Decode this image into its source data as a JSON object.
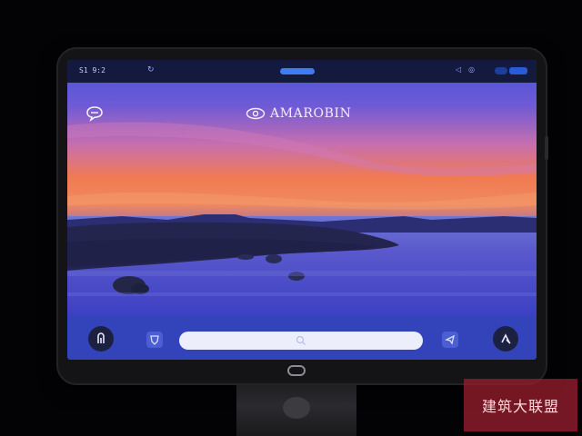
{
  "device": {
    "screen": {
      "status_bar": {
        "time": "S1 9:2",
        "icons": [
          "sync-icon",
          "cast-icon",
          "wifi-icon",
          "battery-icon"
        ]
      },
      "menu_icon": "chat-bubble-icon",
      "brand": {
        "icon": "eye-logo-icon",
        "label": "AMAROBIN"
      },
      "dock": {
        "left_button": "exit-icon",
        "left_square": "shield-icon",
        "search_icon": "search-icon",
        "right_square": "send-icon",
        "right_button": "settings-icon"
      }
    }
  },
  "watermark": {
    "text": "建筑大联盟"
  },
  "colors": {
    "status_accent": "#3e7cf2",
    "dock": "#3344bb",
    "search_bar": "#eceefb",
    "sky_top": "#4653d8",
    "sky_horizon": "#f07a52"
  }
}
